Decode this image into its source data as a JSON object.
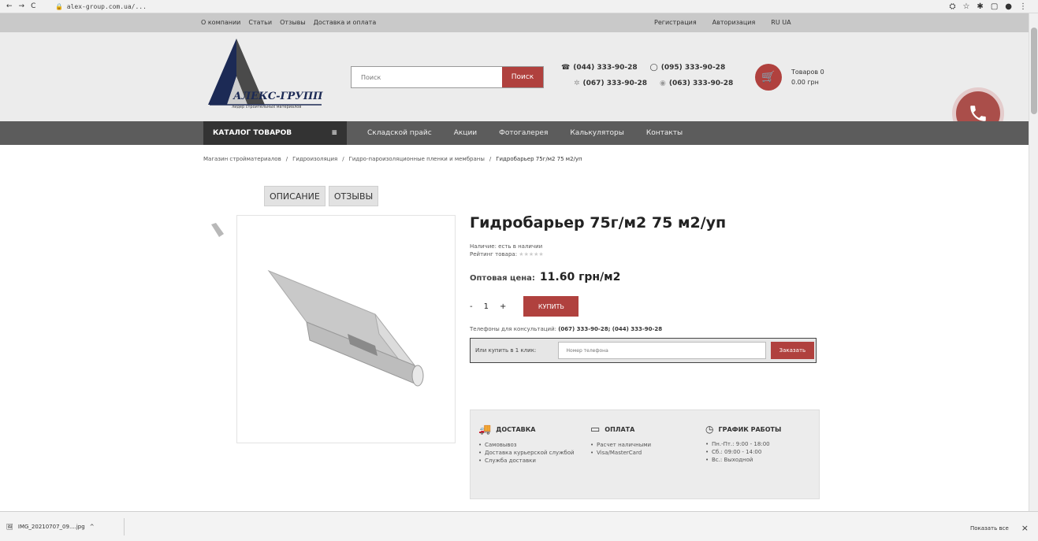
{
  "browser": {
    "url": "alex-group.com.ua/...",
    "back": "←",
    "forward": "→",
    "reload": "C",
    "icons": [
      "translate-icon",
      "star-icon",
      "extensions-icon",
      "window-icon",
      "profile-icon",
      "menu-icon"
    ]
  },
  "topbar": {
    "links": [
      "О компании",
      "Статьи",
      "Отзывы",
      "Доставка и оплата"
    ],
    "register": "Регистрация",
    "login": "Авторизация",
    "lang": "RU UA"
  },
  "header": {
    "logo_text": "АЛЕКС-ГРУПП",
    "logo_sub": "лидер строительных материалов",
    "search_placeholder": "Поиск",
    "search_button": "Поиск",
    "phones": [
      "(044) 333-90-28",
      "(095) 333-90-28",
      "(067) 333-90-28",
      "(063) 333-90-28"
    ],
    "cart_line1": "Товаров 0",
    "cart_line2": "0.00 грн"
  },
  "nav": {
    "catalog": "КАТАЛОГ ТОВАРОВ",
    "items": [
      "Складской прайс",
      "Акции",
      "Фотогалерея",
      "Калькуляторы",
      "Контакты"
    ]
  },
  "breadcrumb": [
    "Магазин стройматериалов",
    "/",
    "Гидроизоляция",
    "/",
    "Гидро-пароизоляционные пленки и мембраны",
    "/",
    "Гидробарьер 75г/м2 75 м2/уп"
  ],
  "tabs": [
    "ОПИСАНИЕ",
    "ОТЗЫВЫ"
  ],
  "product": {
    "title": "Гидробарьер   75г/м2 75 м2/уп",
    "availability": "Наличие: есть в наличии",
    "rating_label": "Рейтинг товара:",
    "rating_value": 0,
    "rating_max": 5,
    "price_label": "Оптовая цена:",
    "price": "11.60 грн/м2",
    "qty_minus": "-",
    "qty": "1",
    "qty_plus": "+",
    "buy": "КУПИТЬ",
    "phone_order_label": "Телефоны для консультаций:",
    "phone_order_numbers": "(067) 333-90-28; (044) 333-90-28",
    "oneclick_label": "Или купить в 1 клик:",
    "oneclick_placeholder": "Номер телефона",
    "oneclick_button": "Заказать"
  },
  "info": {
    "delivery_title": "ДОСТАВКА",
    "delivery_items": [
      "Самовывоз",
      "Доставка курьерской службой",
      "Служба доставки"
    ],
    "payment_title": "ОПЛАТА",
    "payment_items": [
      "Расчет наличными",
      "Visa/MasterCard"
    ],
    "schedule_title": "ГРАФИК РАБОТЫ",
    "schedule_items": [
      "Пн.-Пт.: 9:00 - 18:00",
      "Сб.: 09:00 - 14:00",
      "Вс.: Выходной"
    ]
  },
  "downloads": {
    "file": "IMG_20210707_09....jpg",
    "show_all": "Показать все",
    "close": "×"
  },
  "colors": {
    "accent": "#b0413e",
    "nav": "#5c5c5c",
    "catalog": "#333333"
  }
}
